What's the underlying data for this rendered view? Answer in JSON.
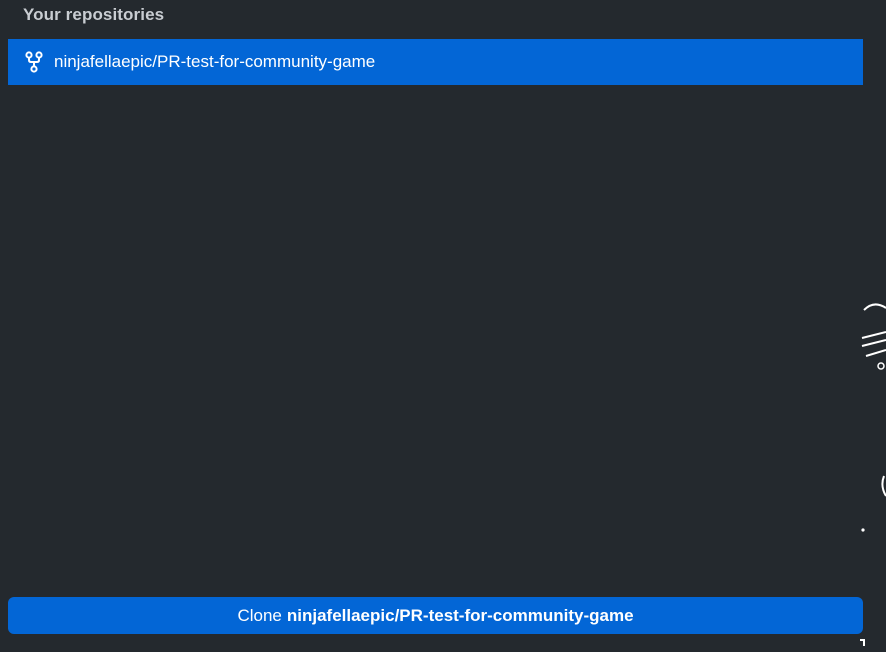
{
  "section": {
    "title": "Your repositories"
  },
  "repositories": [
    {
      "name": "ninjafellaepic/PR-test-for-community-game",
      "icon": "fork-icon",
      "selected": true
    }
  ],
  "clone_button": {
    "prefix": "Clone",
    "repo": "ninjafellaepic/PR-test-for-community-game"
  },
  "colors": {
    "background": "#24292e",
    "accent": "#0366d6",
    "header_text": "#c9cdd2"
  }
}
